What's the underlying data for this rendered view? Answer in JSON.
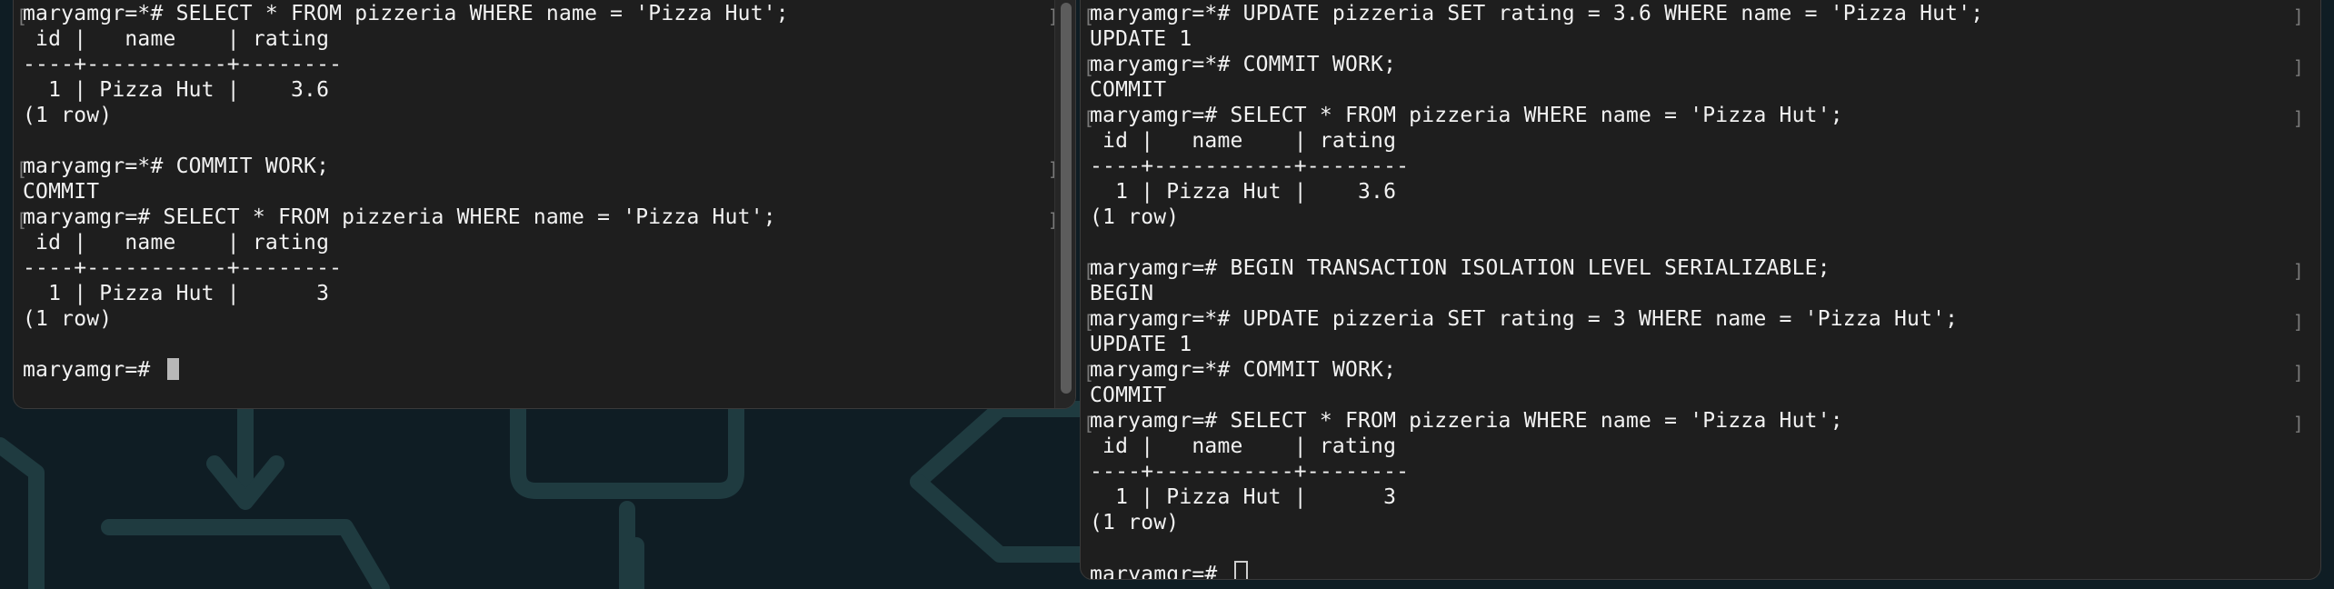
{
  "left_terminal": {
    "lines": [
      {
        "text": "maryamgr=*# SELECT * FROM pizzeria WHERE name = 'Pizza Hut';",
        "bracket": true
      },
      {
        "text": " id |   name    | rating",
        "bracket": false
      },
      {
        "text": "----+-----------+--------",
        "bracket": false
      },
      {
        "text": "  1 | Pizza Hut |    3.6",
        "bracket": false
      },
      {
        "text": "(1 row)",
        "bracket": false
      },
      {
        "text": "",
        "bracket": false
      },
      {
        "text": "maryamgr=*# COMMIT WORK;",
        "bracket": true
      },
      {
        "text": "COMMIT",
        "bracket": false
      },
      {
        "text": "maryamgr=# SELECT * FROM pizzeria WHERE name = 'Pizza Hut';",
        "bracket": true
      },
      {
        "text": " id |   name    | rating",
        "bracket": false
      },
      {
        "text": "----+-----------+--------",
        "bracket": false
      },
      {
        "text": "  1 | Pizza Hut |      3",
        "bracket": false
      },
      {
        "text": "(1 row)",
        "bracket": false
      },
      {
        "text": "",
        "bracket": false
      }
    ],
    "prompt": "maryamgr=# "
  },
  "right_terminal": {
    "lines": [
      {
        "text": "maryamgr=*# UPDATE pizzeria SET rating = 3.6 WHERE name = 'Pizza Hut';",
        "bracket": true
      },
      {
        "text": "UPDATE 1",
        "bracket": false
      },
      {
        "text": "maryamgr=*# COMMIT WORK;",
        "bracket": true
      },
      {
        "text": "COMMIT",
        "bracket": false
      },
      {
        "text": "maryamgr=# SELECT * FROM pizzeria WHERE name = 'Pizza Hut';",
        "bracket": true
      },
      {
        "text": " id |   name    | rating",
        "bracket": false
      },
      {
        "text": "----+-----------+--------",
        "bracket": false
      },
      {
        "text": "  1 | Pizza Hut |    3.6",
        "bracket": false
      },
      {
        "text": "(1 row)",
        "bracket": false
      },
      {
        "text": "",
        "bracket": false
      },
      {
        "text": "maryamgr=# BEGIN TRANSACTION ISOLATION LEVEL SERIALIZABLE;",
        "bracket": true
      },
      {
        "text": "BEGIN",
        "bracket": false
      },
      {
        "text": "maryamgr=*# UPDATE pizzeria SET rating = 3 WHERE name = 'Pizza Hut';",
        "bracket": true
      },
      {
        "text": "UPDATE 1",
        "bracket": false
      },
      {
        "text": "maryamgr=*# COMMIT WORK;",
        "bracket": true
      },
      {
        "text": "COMMIT",
        "bracket": false
      },
      {
        "text": "maryamgr=# SELECT * FROM pizzeria WHERE name = 'Pizza Hut';",
        "bracket": true
      },
      {
        "text": " id |   name    | rating",
        "bracket": false
      },
      {
        "text": "----+-----------+--------",
        "bracket": false
      },
      {
        "text": "  1 | Pizza Hut |      3",
        "bracket": false
      },
      {
        "text": "(1 row)",
        "bracket": false
      },
      {
        "text": "",
        "bracket": false
      }
    ],
    "prompt": "maryamgr=# "
  },
  "colors": {
    "terminal_bg": "#1e1e1e",
    "terminal_text": "#f2f2f2",
    "desktop_bg": "#0f1d24",
    "wallpaper_lines": "#1f3b40"
  }
}
